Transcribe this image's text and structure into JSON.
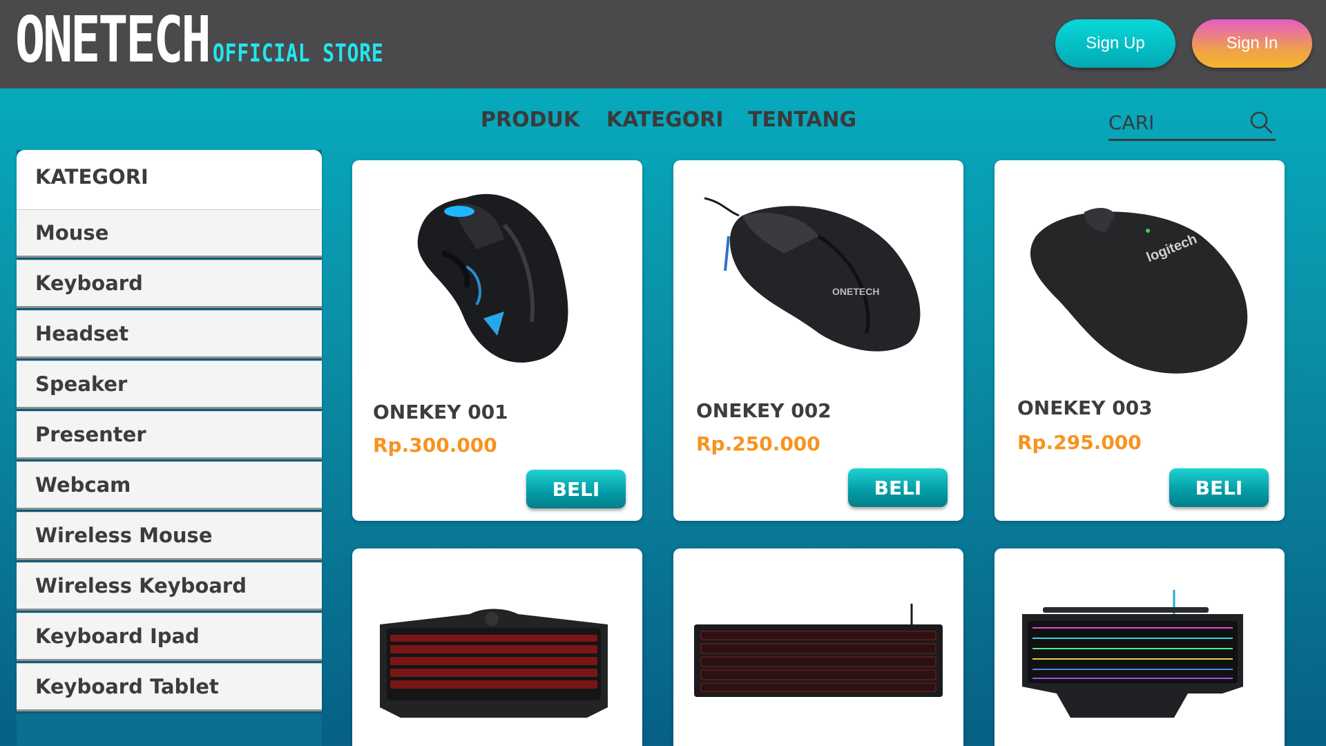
{
  "header": {
    "logo_main": "ONETECH",
    "logo_sub": "OFFICIAL STORE",
    "signup_label": "Sign Up",
    "signin_label": "Sign In"
  },
  "nav": {
    "items": [
      {
        "label": "PRODUK"
      },
      {
        "label": "KATEGORI"
      },
      {
        "label": "TENTANG"
      }
    ],
    "search_placeholder": "CARI",
    "search_icon": "search-icon"
  },
  "sidebar": {
    "title": "KATEGORI",
    "items": [
      {
        "label": "Mouse"
      },
      {
        "label": "Keyboard"
      },
      {
        "label": "Headset"
      },
      {
        "label": "Speaker"
      },
      {
        "label": "Presenter"
      },
      {
        "label": "Webcam"
      },
      {
        "label": "Wireless Mouse"
      },
      {
        "label": "Wireless Keyboard"
      },
      {
        "label": "Keyboard Ipad"
      },
      {
        "label": "Keyboard Tablet"
      }
    ]
  },
  "products": [
    {
      "name": "ONEKEY 001",
      "price": "Rp.300.000",
      "buy_label": "BELI",
      "image": "gaming-mouse-corsair"
    },
    {
      "name": "ONEKEY 002",
      "price": "Rp.250.000",
      "buy_label": "BELI",
      "image": "gaming-mouse-onetech"
    },
    {
      "name": "ONEKEY 003",
      "price": "Rp.295.000",
      "buy_label": "BELI",
      "image": "wireless-mouse-logitech"
    },
    {
      "image": "gaming-keyboard-red"
    },
    {
      "image": "mechanical-keyboard-red"
    },
    {
      "image": "rgb-keyboard-logitech"
    }
  ],
  "brand_marks": {
    "product2_logo": "ONETECH",
    "product3_logo": "logitech"
  },
  "colors": {
    "header_bg": "#4a4a4c",
    "accent_cyan": "#22e6f0",
    "price_orange": "#f7931e",
    "buy_button": "#029aa5"
  }
}
